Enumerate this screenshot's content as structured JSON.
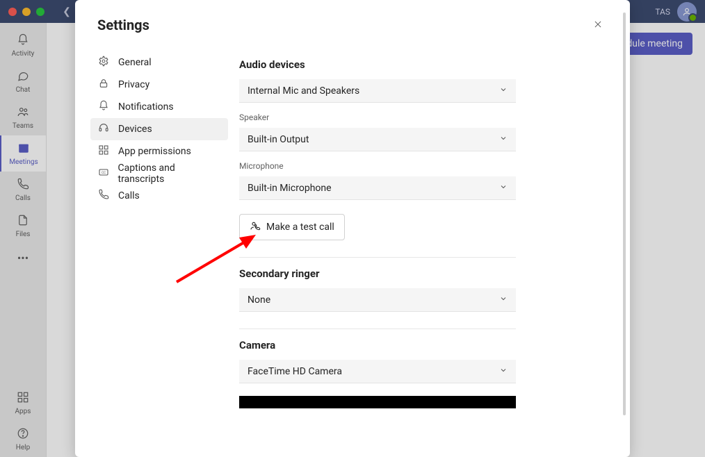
{
  "titlebar": {
    "user_initials": "TAS"
  },
  "rail": {
    "items": [
      {
        "label": "Activity"
      },
      {
        "label": "Chat"
      },
      {
        "label": "Teams"
      },
      {
        "label": "Meetings"
      },
      {
        "label": "Calls"
      },
      {
        "label": "Files"
      }
    ],
    "bottom": [
      {
        "label": "Apps"
      },
      {
        "label": "Help"
      }
    ]
  },
  "background": {
    "schedule_meeting": "Schedule meeting"
  },
  "modal": {
    "title": "Settings",
    "nav": [
      {
        "label": "General"
      },
      {
        "label": "Privacy"
      },
      {
        "label": "Notifications"
      },
      {
        "label": "Devices"
      },
      {
        "label": "App permissions"
      },
      {
        "label": "Captions and transcripts"
      },
      {
        "label": "Calls"
      }
    ],
    "panel": {
      "audio_devices_title": "Audio devices",
      "audio_devices_value": "Internal Mic and Speakers",
      "speaker_label": "Speaker",
      "speaker_value": "Built-in Output",
      "microphone_label": "Microphone",
      "microphone_value": "Built-in Microphone",
      "test_call_label": "Make a test call",
      "secondary_ringer_title": "Secondary ringer",
      "secondary_ringer_value": "None",
      "camera_title": "Camera",
      "camera_value": "FaceTime HD Camera"
    }
  }
}
